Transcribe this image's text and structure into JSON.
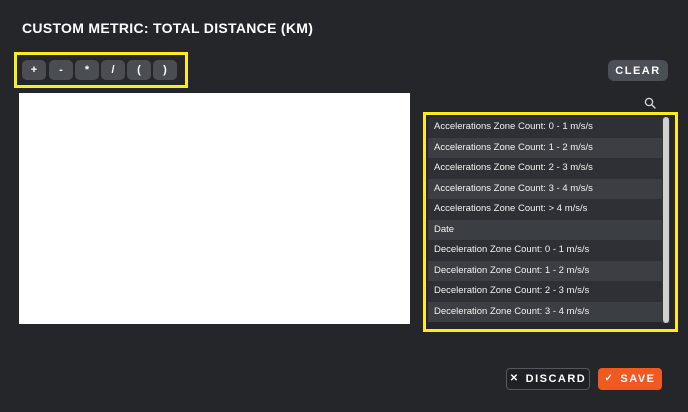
{
  "title": "CUSTOM METRIC: TOTAL DISTANCE (KM)",
  "operators": [
    "+",
    "-",
    "*",
    "/",
    "(",
    ")"
  ],
  "clear_label": "CLEAR",
  "metrics": [
    "Accelerations Zone Count: 0 - 1 m/s/s",
    "Accelerations Zone Count: 1 - 2 m/s/s",
    "Accelerations Zone Count: 2 - 3 m/s/s",
    "Accelerations Zone Count: 3 - 4 m/s/s",
    "Accelerations Zone Count: > 4 m/s/s",
    "Date",
    "Deceleration Zone Count: 0 - 1 m/s/s",
    "Deceleration Zone Count: 1 - 2 m/s/s",
    "Deceleration Zone Count: 2 - 3 m/s/s",
    "Deceleration Zone Count: 3 - 4 m/s/s"
  ],
  "discard_label": "DISCARD",
  "save_label": "SAVE",
  "colors": {
    "background": "#24262a",
    "highlight": "#ffec1a",
    "save": "#f05a22"
  },
  "icons": {
    "search": "search-icon",
    "discard": "close-icon",
    "save": "check-icon"
  }
}
